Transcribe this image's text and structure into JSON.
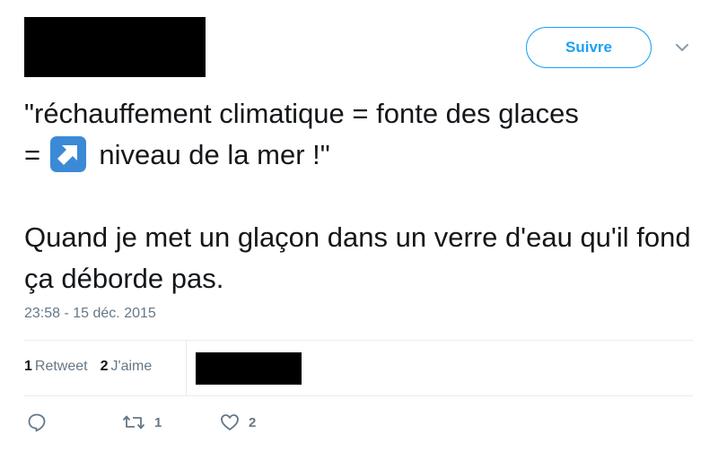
{
  "follow_button": {
    "label": "Suivre"
  },
  "tweet": {
    "line1": "\"réchauffement climatique = fonte des glaces",
    "line2_prefix": "= ",
    "line2_suffix": " niveau de la mer !\"",
    "emoji": "arrow-upper-right-emoji",
    "paragraph2": "Quand je met un glaçon dans un verre d'eau qu'il fond ça déborde pas."
  },
  "timestamp": "23:58 - 15 déc. 2015",
  "stats": {
    "retweets_count": "1",
    "retweets_label": "Retweet",
    "likes_count": "2",
    "likes_label": "J'aime"
  },
  "actions": {
    "reply_icon": "reply-icon",
    "retweet_icon": "retweet-icon",
    "retweet_count": "1",
    "like_icon": "heart-icon",
    "like_count": "2"
  },
  "colors": {
    "accent": "#1da1f2",
    "muted": "#657786",
    "text": "#14171a",
    "divider": "#e6ecf0",
    "emoji_bg": "#3b8ad6"
  }
}
